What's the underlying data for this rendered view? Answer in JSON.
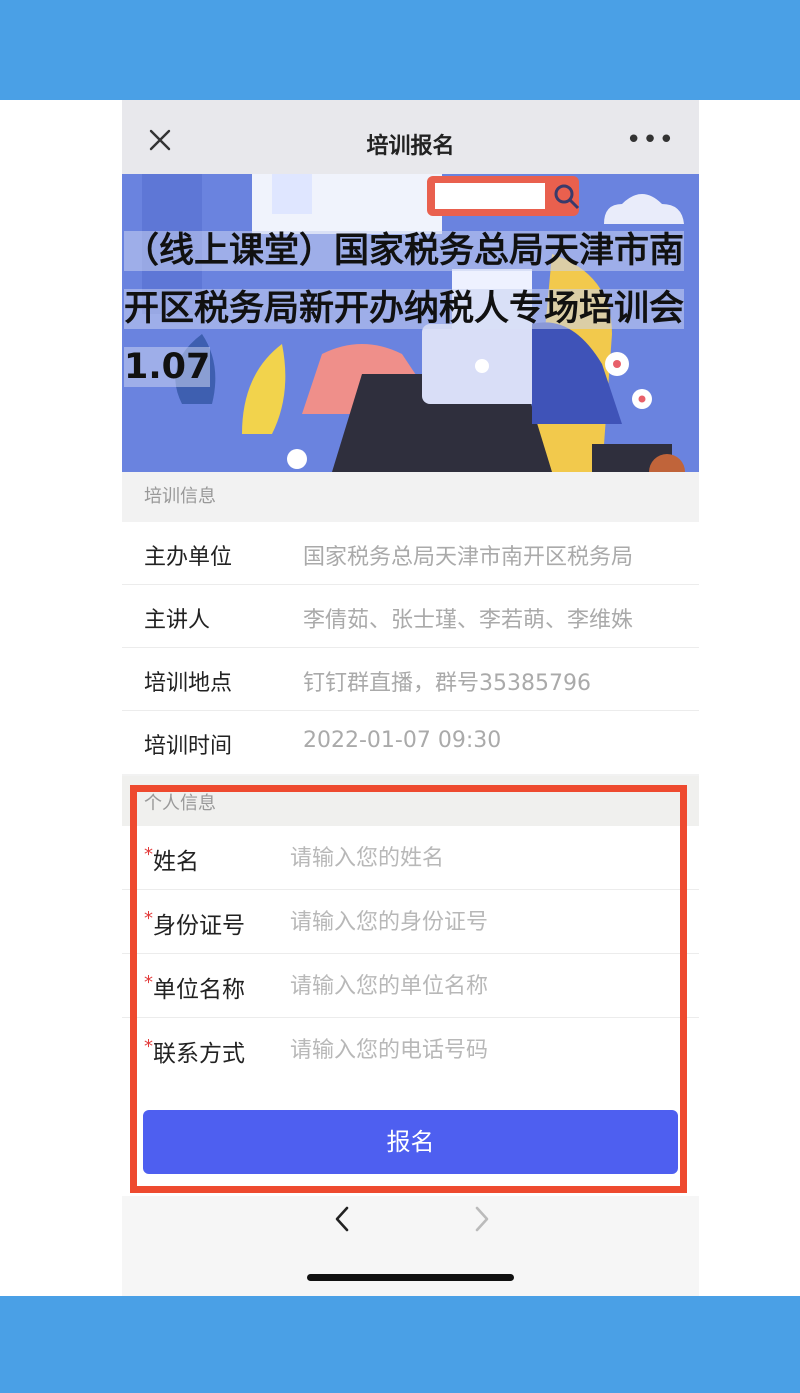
{
  "nav": {
    "title": "培训报名",
    "close_icon": "close-icon",
    "more_icon": "more-icon",
    "more_glyph": "•••"
  },
  "banner": {
    "title": "（线上课堂）国家税务总局天津市南开区税务局新开办纳税人专场培训会1.07"
  },
  "training_info": {
    "section_label": "培训信息",
    "rows": [
      {
        "key": "主办单位",
        "value": "国家税务总局天津市南开区税务局"
      },
      {
        "key": "主讲人",
        "value": "李倩茹、张士瑾、李若萌、李维姝"
      },
      {
        "key": "培训地点",
        "value": "钉钉群直播，群号35385796"
      },
      {
        "key": "培训时间",
        "value": "2022-01-07 09:30"
      }
    ]
  },
  "personal_info": {
    "section_label": "个人信息",
    "required_mark": "*",
    "fields": [
      {
        "label": "姓名",
        "placeholder": "请输入您的姓名",
        "value": ""
      },
      {
        "label": "身份证号",
        "placeholder": "请输入您的身份证号",
        "value": ""
      },
      {
        "label": "单位名称",
        "placeholder": "请输入您的单位名称",
        "value": ""
      },
      {
        "label": "联系方式",
        "placeholder": "请输入您的电话号码",
        "value": ""
      }
    ],
    "submit_label": "报名"
  },
  "colors": {
    "accent_button": "#4e5ff0",
    "highlight_frame": "#ee4a2f",
    "page_band": "#4aa0e6",
    "required_mark": "#e23b3b"
  }
}
